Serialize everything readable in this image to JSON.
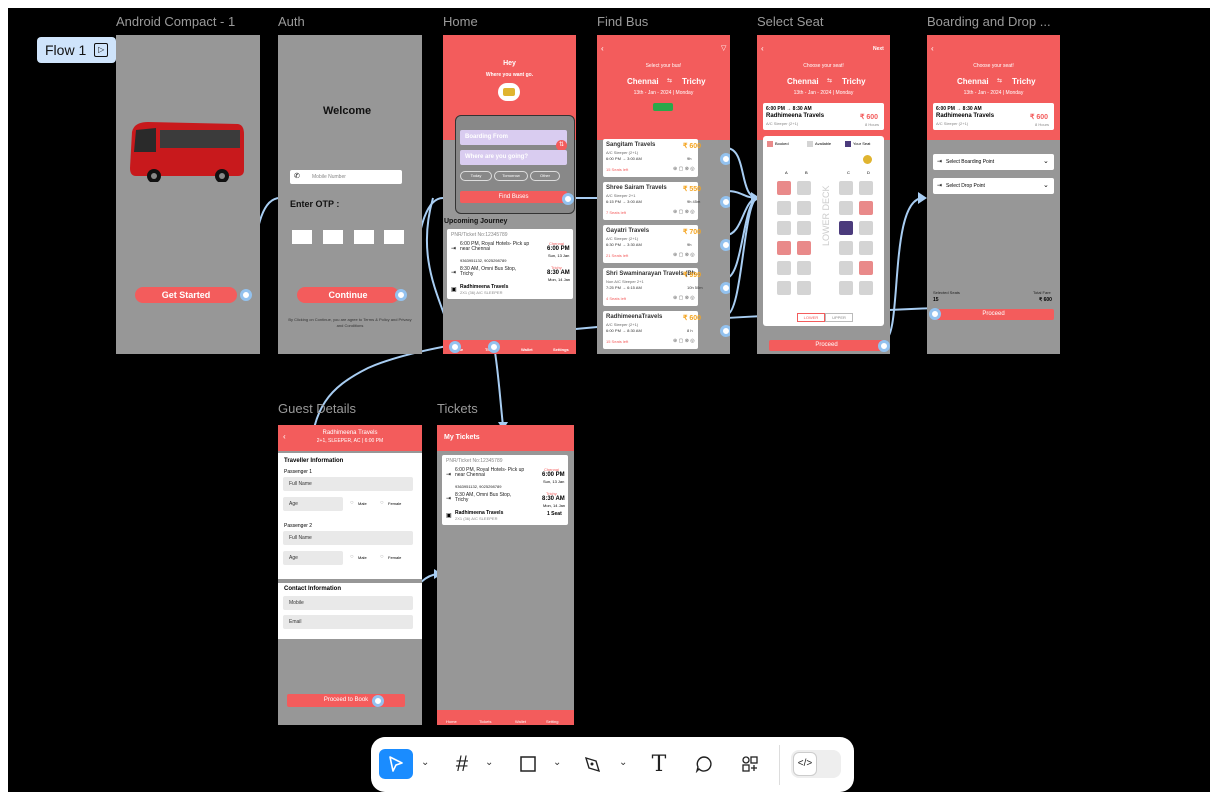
{
  "canvas": {
    "bg": "#000000",
    "frame_bg": "#979797",
    "accent": "#f35c5c"
  },
  "flow_badge": {
    "label": "Flow 1",
    "icon": "play-square-icon"
  },
  "frames": {
    "android": {
      "title": "Android Compact - 1",
      "button": "Get Started"
    },
    "auth": {
      "title": "Auth",
      "welcome": "Welcome",
      "mobile_placeholder": "Mobile Number",
      "otp_label": "Enter OTP :",
      "button": "Continue",
      "terms": "By Clicking on Continue, you are agree to Terms & Policy and Privacy and Conditions"
    },
    "home": {
      "title": "Home",
      "hey": "Hey",
      "sub": "Where you want go.",
      "from": "Boarding From",
      "to": "Where are you going?",
      "chips": [
        "Today",
        "Tomorrow",
        "Other"
      ],
      "find": "Find Buses",
      "upcoming": "Upcoming Journey",
      "ticket": {
        "pnr": "PNR/Ticket No:12345789",
        "boarding": "6:00 PM, Royal Hotels- Pick up near Chennai",
        "boarding_phone": "9363951132, 9025298789",
        "drop": "8:30 AM, Omni Bus Stop, Trichy",
        "from_city": "Chennai",
        "from_time": "6:00 PM",
        "from_date": "Sun, 13 Jan",
        "to_city": "Trichy",
        "to_time": "8:30 AM",
        "to_date": "Mon, 14 Jan",
        "travels": "Radhimeena Travels",
        "travels_sub": "2X1 (36) A/C SLEEPER"
      },
      "nav": [
        "Home",
        "Tickets",
        "Wallet",
        "Settings"
      ]
    },
    "findbus": {
      "title": "Find Bus",
      "header": "Select your bus!",
      "from": "Chennai",
      "to": "Trichy",
      "date": "13th - Jan - 2024 | Monday",
      "buses": [
        {
          "name": "Sangitam Travels",
          "type": "A/C Sleeper (2+1)",
          "time": "6:00 PM → 3:00 AM",
          "dur": "9h",
          "price": "₹ 600",
          "seats": "15 Seats left"
        },
        {
          "name": "Shree Sairam Travels",
          "type": "A/C Sleeper 2+1",
          "time": "6:15 PM → 3:00 AM",
          "dur": "9h 45m",
          "price": "₹ 550",
          "seats": "7 Seats left"
        },
        {
          "name": "Gayatri Travels",
          "type": "A/C Sleeper (2+1)",
          "time": "6:30 PM → 3:30 AM",
          "dur": "9h",
          "price": "₹ 700",
          "seats": "21 Seats left"
        },
        {
          "name": "Shri Swaminarayan Travels (Bh...",
          "type": "Non A/C Sleeper 2+1",
          "time": "7:25 PM → 6:15 AM",
          "dur": "10h 50m",
          "price": "₹ 999",
          "seats": "4 Seats left"
        },
        {
          "name": "RadhimeenaTravels",
          "type": "A/C Sleeper (2+1)",
          "time": "6:00 PM → 8:30 AM",
          "dur": "8 h",
          "price": "₹ 600",
          "seats": "15 Seats left"
        }
      ]
    },
    "seat": {
      "title": "Select Seat",
      "next": "Next",
      "header": "Choose your seat!",
      "from": "Chennai",
      "to": "Trichy",
      "date": "13th - Jan - 2024 | Monday",
      "bus_time": "6:00 PM → 8:30 AM",
      "bus_name": "Radhimeena Travels",
      "bus_type": "A/C Sleeper (2+1)",
      "price": "₹ 600",
      "hours": "8 Hours",
      "legend": [
        "Booked",
        "Available",
        "Your Seat"
      ],
      "cols": [
        "A",
        "B",
        "C",
        "D"
      ],
      "deck": "LOWER DECK",
      "tabs": [
        "LOWER",
        "UPPER"
      ],
      "proceed": "Proceed"
    },
    "board": {
      "title": "Boarding and Drop ...",
      "header": "Choose your seat!",
      "from": "Chennai",
      "to": "Trichy",
      "date": "13th - Jan - 2024 | Monday",
      "bus_time": "6:00 PM → 8:30 AM",
      "bus_name": "Radhimeena Travels",
      "bus_type": "A/C Sleeper (2+1)",
      "price": "₹ 600",
      "hours": "8 Hours",
      "boarding": "Select Boarding Point",
      "drop": "Select Drop Point",
      "selected_label": "Selected Seats",
      "selected": "15",
      "total_label": "Total Fare",
      "total": "₹ 600",
      "proceed": "Proceed"
    },
    "guest": {
      "title": "Guest Details",
      "bus_name": "Radhimeena Travels",
      "bus_sub": "2+1, SLEEPER, AC | 6:00 PM",
      "traveller": "Traveller Information",
      "p1": "Passenger 1",
      "p2": "Passenger 2",
      "full_name": "Full Name",
      "age": "Age",
      "male": "Male",
      "female": "Female",
      "contact": "Contact Information",
      "mobile": "Mobile",
      "email": "Email",
      "proceed": "Proceed to Book"
    },
    "tickets": {
      "title": "Tickets",
      "header": "My Tickets",
      "seat_count": "1 Seat",
      "nav": [
        "Home",
        "Tickets",
        "Wallet",
        "Setting"
      ]
    }
  },
  "toolbar": {
    "tools": [
      "cursor-icon",
      "frame-icon",
      "rectangle-icon",
      "pen-icon",
      "text-icon",
      "comment-icon",
      "shapes-icon",
      "code-icon"
    ],
    "active": "cursor-icon"
  }
}
